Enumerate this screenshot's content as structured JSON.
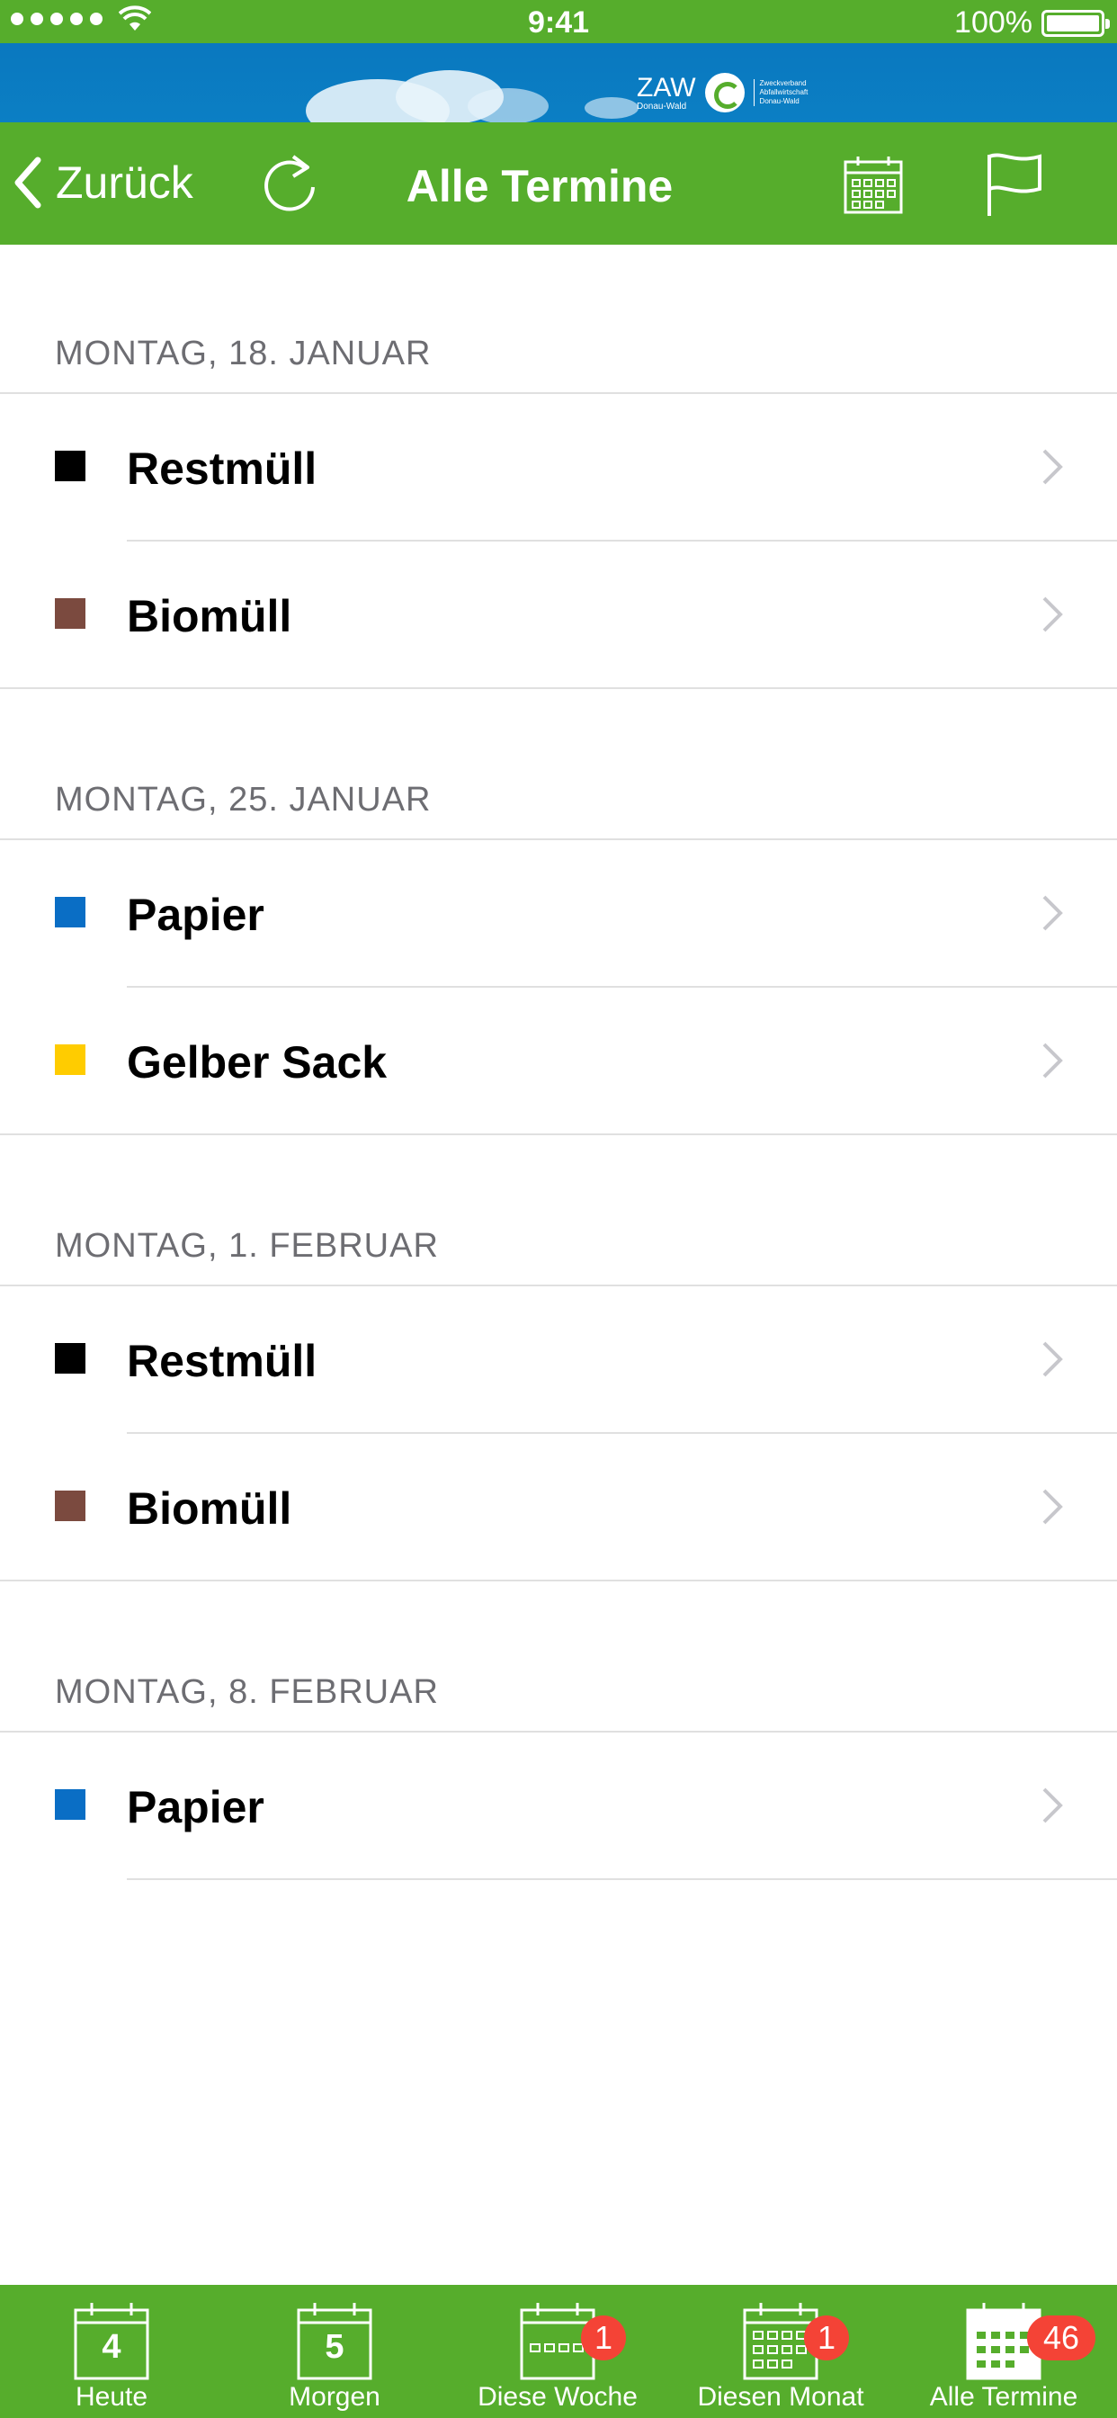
{
  "status_bar": {
    "time": "9:41",
    "battery": "100%"
  },
  "banner": {
    "logo_text": "ZAW",
    "logo_sub": "Donau-Wald",
    "logo_small": "Zweckverband Abfallwirtschaft Donau-Wald"
  },
  "nav": {
    "back_label": "Zurück",
    "title": "Alle Termine"
  },
  "sections": [
    {
      "header": "MONTAG, 18. JANUAR",
      "items": [
        {
          "label": "Restmüll",
          "color": "#000000"
        },
        {
          "label": "Biomüll",
          "color": "#7b4a3f"
        }
      ]
    },
    {
      "header": "MONTAG, 25. JANUAR",
      "items": [
        {
          "label": "Papier",
          "color": "#0a6ec5"
        },
        {
          "label": "Gelber Sack",
          "color": "#ffcc00"
        }
      ]
    },
    {
      "header": "MONTAG, 1. FEBRUAR",
      "items": [
        {
          "label": "Restmüll",
          "color": "#000000"
        },
        {
          "label": "Biomüll",
          "color": "#7b4a3f"
        }
      ]
    },
    {
      "header": "MONTAG, 8. FEBRUAR",
      "items": [
        {
          "label": "Papier",
          "color": "#0a6ec5"
        }
      ]
    }
  ],
  "tabs": [
    {
      "label": "Heute",
      "day": "4",
      "badge": ""
    },
    {
      "label": "Morgen",
      "day": "5",
      "badge": ""
    },
    {
      "label": "Diese Woche",
      "day": "",
      "badge": "1"
    },
    {
      "label": "Diesen Monat",
      "day": "",
      "badge": "1"
    },
    {
      "label": "Alle Termine",
      "day": "",
      "badge": "46"
    }
  ],
  "colors": {
    "accent_green": "#56ad2c",
    "banner_blue": "#0a78bf",
    "badge_red": "#f44336"
  }
}
